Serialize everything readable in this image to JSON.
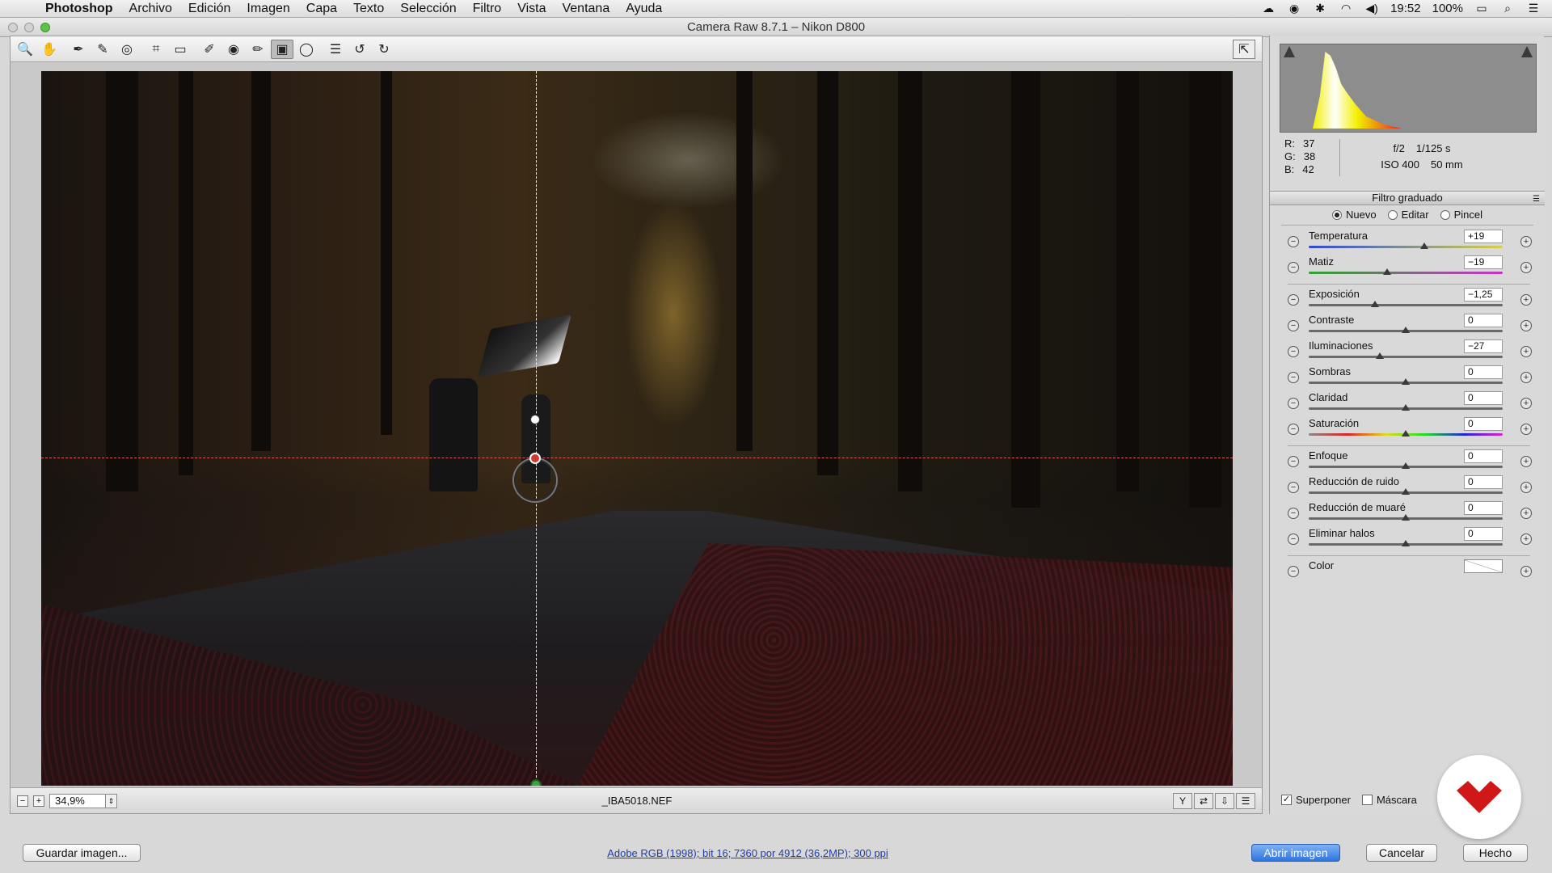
{
  "menubar": {
    "apple_icon": "apple-icon",
    "app_name": "Photoshop",
    "items": [
      "Archivo",
      "Edición",
      "Imagen",
      "Capa",
      "Texto",
      "Selección",
      "Filtro",
      "Vista",
      "Ventana",
      "Ayuda"
    ],
    "time": "19:52",
    "battery": "100%"
  },
  "window": {
    "title": "Camera Raw 8.7.1 –  Nikon D800"
  },
  "toolbar": {
    "tools": [
      {
        "name": "zoom-tool",
        "icon": "🔍"
      },
      {
        "name": "hand-tool",
        "icon": "✋"
      },
      {
        "name": "white-balance-tool",
        "icon": "✒"
      },
      {
        "name": "color-sampler-tool",
        "icon": "✎"
      },
      {
        "name": "targeted-adjustment-tool",
        "icon": "◎"
      },
      {
        "name": "crop-tool",
        "icon": "⌗"
      },
      {
        "name": "straighten-tool",
        "icon": "▭"
      },
      {
        "name": "spot-removal-tool",
        "icon": "✐"
      },
      {
        "name": "red-eye-tool",
        "icon": "◉"
      },
      {
        "name": "adjustment-brush-tool",
        "icon": "✏"
      },
      {
        "name": "graduated-filter-tool",
        "icon": "▣"
      },
      {
        "name": "radial-filter-tool",
        "icon": "◯"
      },
      {
        "name": "preferences-tool",
        "icon": "☰"
      },
      {
        "name": "rotate-left-tool",
        "icon": "↺"
      },
      {
        "name": "rotate-right-tool",
        "icon": "↻"
      }
    ],
    "fullscreen_icon": "⇱"
  },
  "status": {
    "zoom": "34,9%",
    "filename": "_IBA5018.NEF"
  },
  "readout": {
    "r_label": "R:",
    "r": "37",
    "g_label": "G:",
    "g": "38",
    "b_label": "B:",
    "b": "42",
    "aperture": "f/2",
    "shutter": "1/125 s",
    "iso": "ISO 400",
    "focal": "50 mm"
  },
  "panel": {
    "title": "Filtro graduado",
    "modes": [
      {
        "label": "Nuevo",
        "selected": true
      },
      {
        "label": "Editar",
        "selected": false
      },
      {
        "label": "Pincel",
        "selected": false
      }
    ],
    "groups": [
      [
        {
          "label": "Temperatura",
          "value": "+19",
          "position": 0.595,
          "track": "temp"
        },
        {
          "label": "Matiz",
          "value": "−19",
          "position": 0.405,
          "track": "tint"
        }
      ],
      [
        {
          "label": "Exposición",
          "value": "−1,25",
          "position": 0.34,
          "track": "plain"
        },
        {
          "label": "Contraste",
          "value": "0",
          "position": 0.5,
          "track": "plain"
        },
        {
          "label": "Iluminaciones",
          "value": "−27",
          "position": 0.365,
          "track": "plain"
        },
        {
          "label": "Sombras",
          "value": "0",
          "position": 0.5,
          "track": "plain"
        },
        {
          "label": "Claridad",
          "value": "0",
          "position": 0.5,
          "track": "plain"
        },
        {
          "label": "Saturación",
          "value": "0",
          "position": 0.5,
          "track": "sat"
        }
      ],
      [
        {
          "label": "Enfoque",
          "value": "0",
          "position": 0.5,
          "track": "plain"
        },
        {
          "label": "Reducción de ruido",
          "value": "0",
          "position": 0.5,
          "track": "plain"
        },
        {
          "label": "Reducción de muaré",
          "value": "0",
          "position": 0.5,
          "track": "plain"
        },
        {
          "label": "Eliminar halos",
          "value": "0",
          "position": 0.5,
          "track": "plain"
        }
      ]
    ],
    "color_label": "Color",
    "overlay_label": "Superponer",
    "overlay_checked": true,
    "mask_label": "Máscara",
    "mask_checked": false
  },
  "bottom": {
    "save_label": "Guardar imagen...",
    "workflow": "Adobe RGB (1998); bit 16; 7360 por 4912 (36,2MP); 300 ppi",
    "open_label": "Abrir imagen",
    "cancel_label": "Cancelar",
    "done_label": "Hecho"
  }
}
